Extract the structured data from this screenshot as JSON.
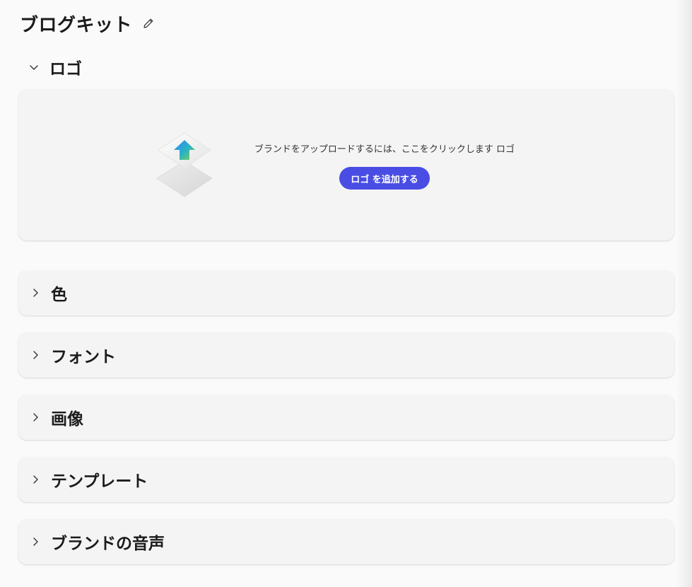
{
  "kit": {
    "title": "ブログキット"
  },
  "logo_section": {
    "label": "ロゴ",
    "upload_text": "ブランドをアップロードするには、ここをクリックします ロゴ",
    "add_button": "ロゴ を追加する"
  },
  "sections": [
    {
      "label": "色"
    },
    {
      "label": "フォント"
    },
    {
      "label": "画像"
    },
    {
      "label": "テンプレート"
    },
    {
      "label": "ブランドの音声"
    }
  ],
  "colors": {
    "accent": "#4a4de3",
    "panel": "#f4f4f4",
    "background": "#fafafa"
  },
  "icons": {
    "edit": "pencil-icon",
    "expanded": "chevron-down-icon",
    "collapsed": "chevron-right-icon",
    "upload": "upload-arrow-icon"
  }
}
